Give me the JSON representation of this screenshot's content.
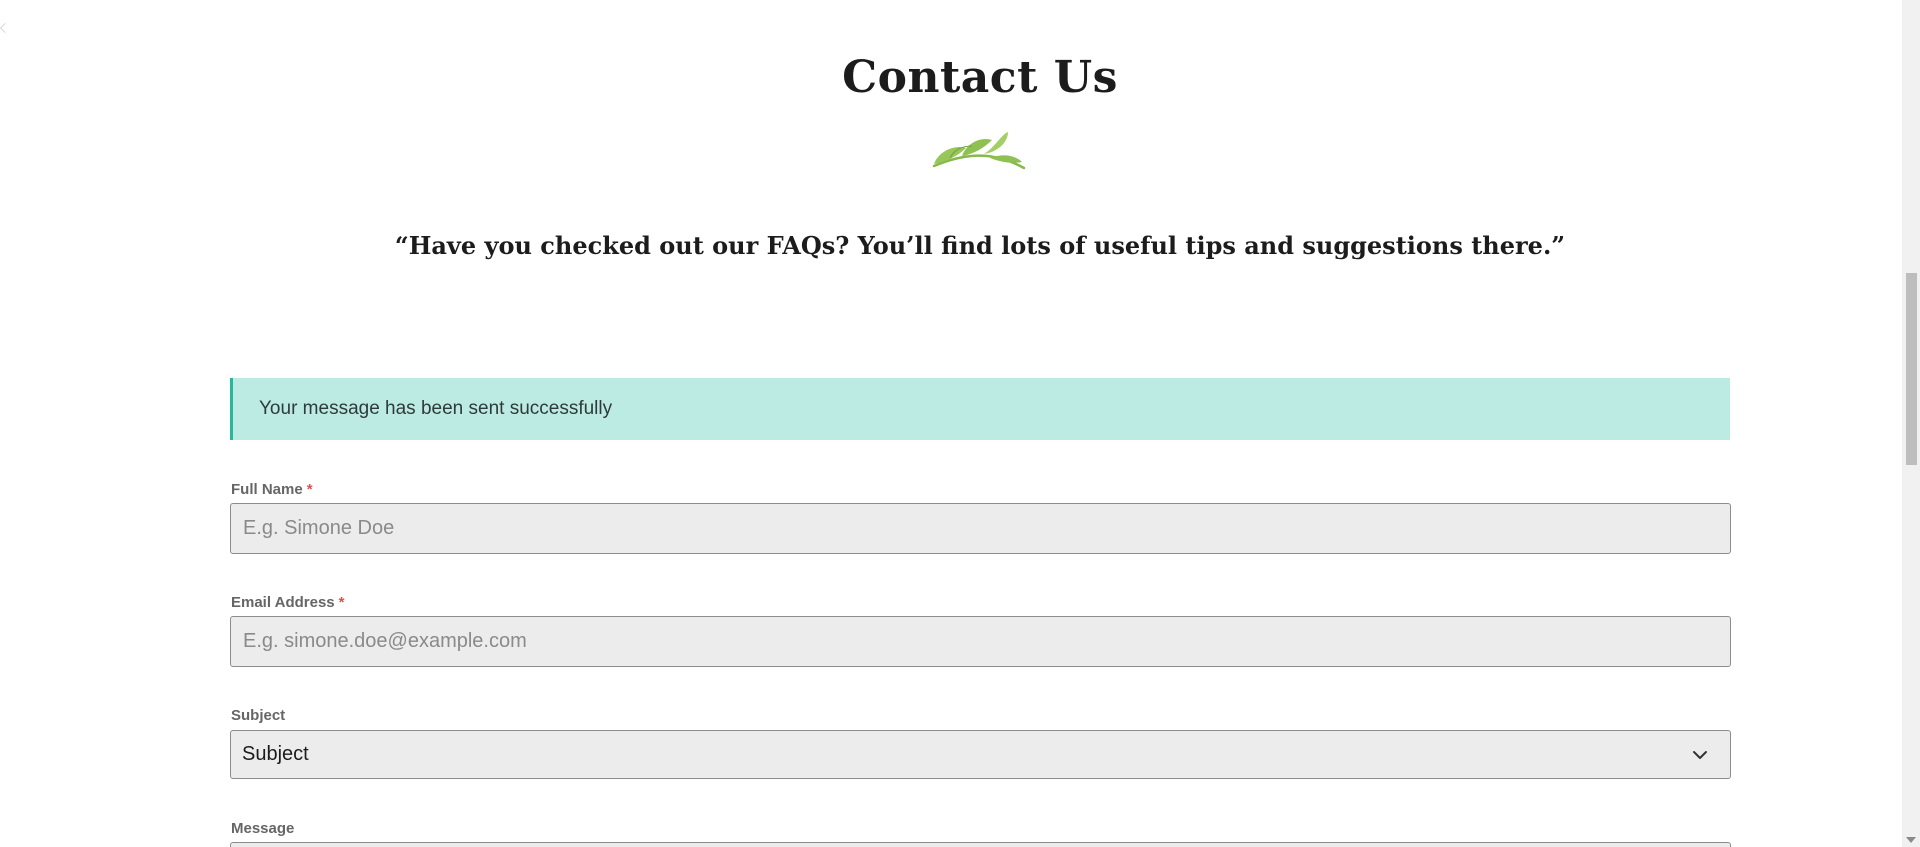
{
  "page": {
    "title": "Contact Us",
    "quote": "“Have you checked out our FAQs? You’ll find lots of useful tips and suggestions there.”"
  },
  "alert": {
    "text": "Your message has been sent successfully",
    "color": "#bcebe3",
    "accent": "#26b79c"
  },
  "form": {
    "full_name": {
      "label": "Full Name",
      "required_mark": "*",
      "placeholder": "E.g. Simone Doe",
      "value": ""
    },
    "email": {
      "label": "Email Address",
      "required_mark": "*",
      "placeholder": "E.g. simone.doe@example.com",
      "value": ""
    },
    "subject": {
      "label": "Subject",
      "selected": "Subject"
    },
    "message": {
      "label": "Message"
    }
  },
  "icons": {
    "decoration": "olive-branch-icon",
    "dropdown": "chevron-down-icon"
  }
}
